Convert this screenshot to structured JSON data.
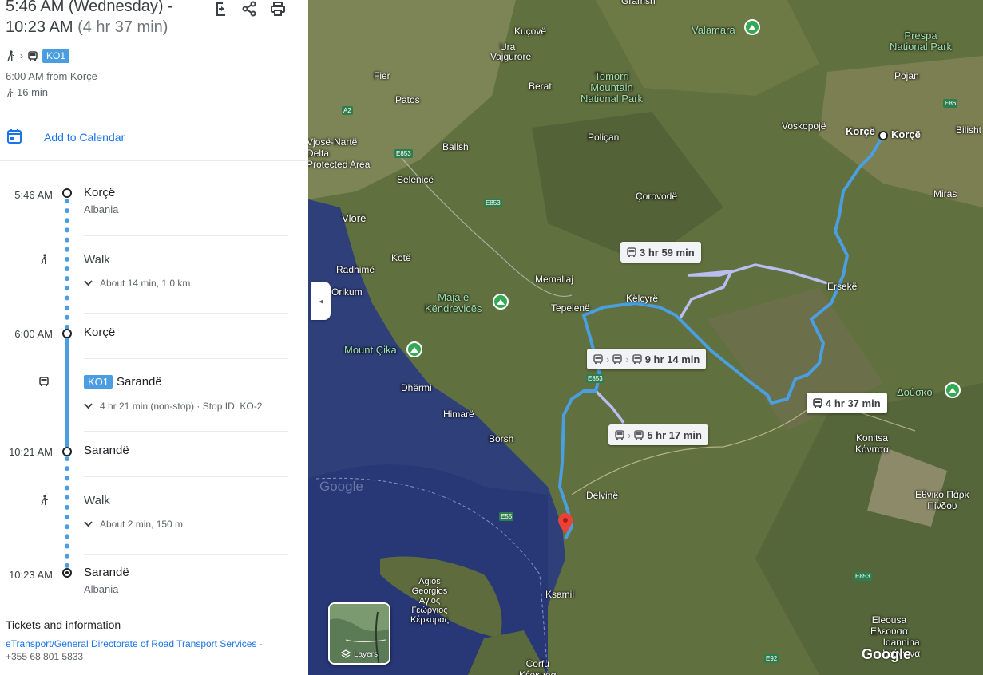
{
  "header": {
    "time_line1": "5:46 AM (Wednesday) -",
    "time_line2": "10:23 AM",
    "duration": "(4 hr 37 min)",
    "route_badge": "KO1",
    "depart": "6:00 AM from Korçë",
    "walk_total": "16 min"
  },
  "calendar": {
    "label": "Add to Calendar"
  },
  "timeline": {
    "start": {
      "time": "5:46 AM",
      "name": "Korçë",
      "sub": "Albania"
    },
    "walk1": {
      "label": "Walk",
      "detail": "About 14 min, 1.0 km"
    },
    "board": {
      "time": "6:00 AM",
      "name": "Korçë"
    },
    "bus": {
      "badge": "KO1",
      "destination": "Sarandë",
      "detail": "4 hr 21 min (non-stop) · Stop ID: KO-2"
    },
    "alight": {
      "time": "10:21 AM",
      "name": "Sarandë"
    },
    "walk2": {
      "label": "Walk",
      "detail": "About 2 min, 150 m"
    },
    "end": {
      "time": "10:23 AM",
      "name": "Sarandë",
      "sub": "Albania"
    }
  },
  "tickets": {
    "title": "Tickets and information",
    "link": "eTransport/General Directorate of Road Transport Services",
    "dash": "-",
    "phone": "+355 68 801 5833"
  },
  "map": {
    "routes": [
      {
        "label": "3 hr 59 min"
      },
      {
        "label": "9 hr 14 min"
      },
      {
        "label": "4 hr 37 min"
      },
      {
        "label": "5 hr 17 min"
      }
    ],
    "places": {
      "gramsh": "Gramsh",
      "kucove": "Kuçovë",
      "ura": "Ura",
      "vajgurore": "Vajgurore",
      "fier": "Fier",
      "berat": "Berat",
      "patos": "Patos",
      "tomorri": "Tomorri\nMountain\nNational Park",
      "valamara": "Valamara",
      "prespa": "Prespa\nNational Park",
      "pojan": "Pojan",
      "voskopoje": "Voskopojë",
      "korce1": "Korçë",
      "korce2": "Korçë",
      "bilisht": "Bilisht",
      "vjose": "Vjosë-Nartë\nDelta\nProtected Area",
      "ballsh": "Ballsh",
      "polican": "Poliçan",
      "selenice": "Selenicë",
      "corovode": "Çorovodë",
      "miras": "Miras",
      "vlore": "Vlorë",
      "radhime": "Radhimë",
      "kote": "Kotë",
      "orikum": "Orikum",
      "memaliaj": "Memaliaj",
      "maja": "Maja e\nKëndrevicës",
      "tepelene": "Tepelenë",
      "kelcyre": "Këlcyrë",
      "erseke": "Ersekë",
      "mount_cika": "Mount Çika",
      "dhermi": "Dhërmi",
      "himare": "Himarë",
      "borsh": "Borsh",
      "dousko": "Δούσκο",
      "konitsa": "Konitsa\nΚόνιτσα",
      "delvine": "Delvinë",
      "pindos": "Εθνικό Πάρκ\nΠίνδου",
      "agios": "Agios\nGeorgios\nΆγιος\nΓεώργιος\nΚέρκυρας",
      "ksamil": "Ksamil",
      "eleousa": "Eleousa\nΕλεούσα",
      "ioannina": "Ioannina\nΙωάννινα",
      "corfu": "Corfu\nΚέρκυρα"
    },
    "roads": {
      "a2": "A2",
      "e853a": "E853",
      "e853b": "E853",
      "e853c": "E853",
      "e853d": "E853",
      "e86": "E86",
      "e55": "E55",
      "e92": "E92"
    },
    "layers_label": "Layers",
    "watermark": "Google",
    "logo": "Google"
  },
  "icons": {
    "download": "download-icon",
    "share": "share-icon",
    "print": "print-icon",
    "walk": "walk-icon",
    "bus": "bus-icon",
    "calendar": "calendar-icon",
    "chevron": "chevron-down-icon",
    "park": "park-icon",
    "pin": "destination-pin-icon"
  },
  "colors": {
    "accent": "#4a9de0",
    "link": "#1a73e8",
    "route_main": "#4a9fe0",
    "route_alt": "#b8bff0",
    "park": "#34a853",
    "pin": "#ea4335"
  }
}
